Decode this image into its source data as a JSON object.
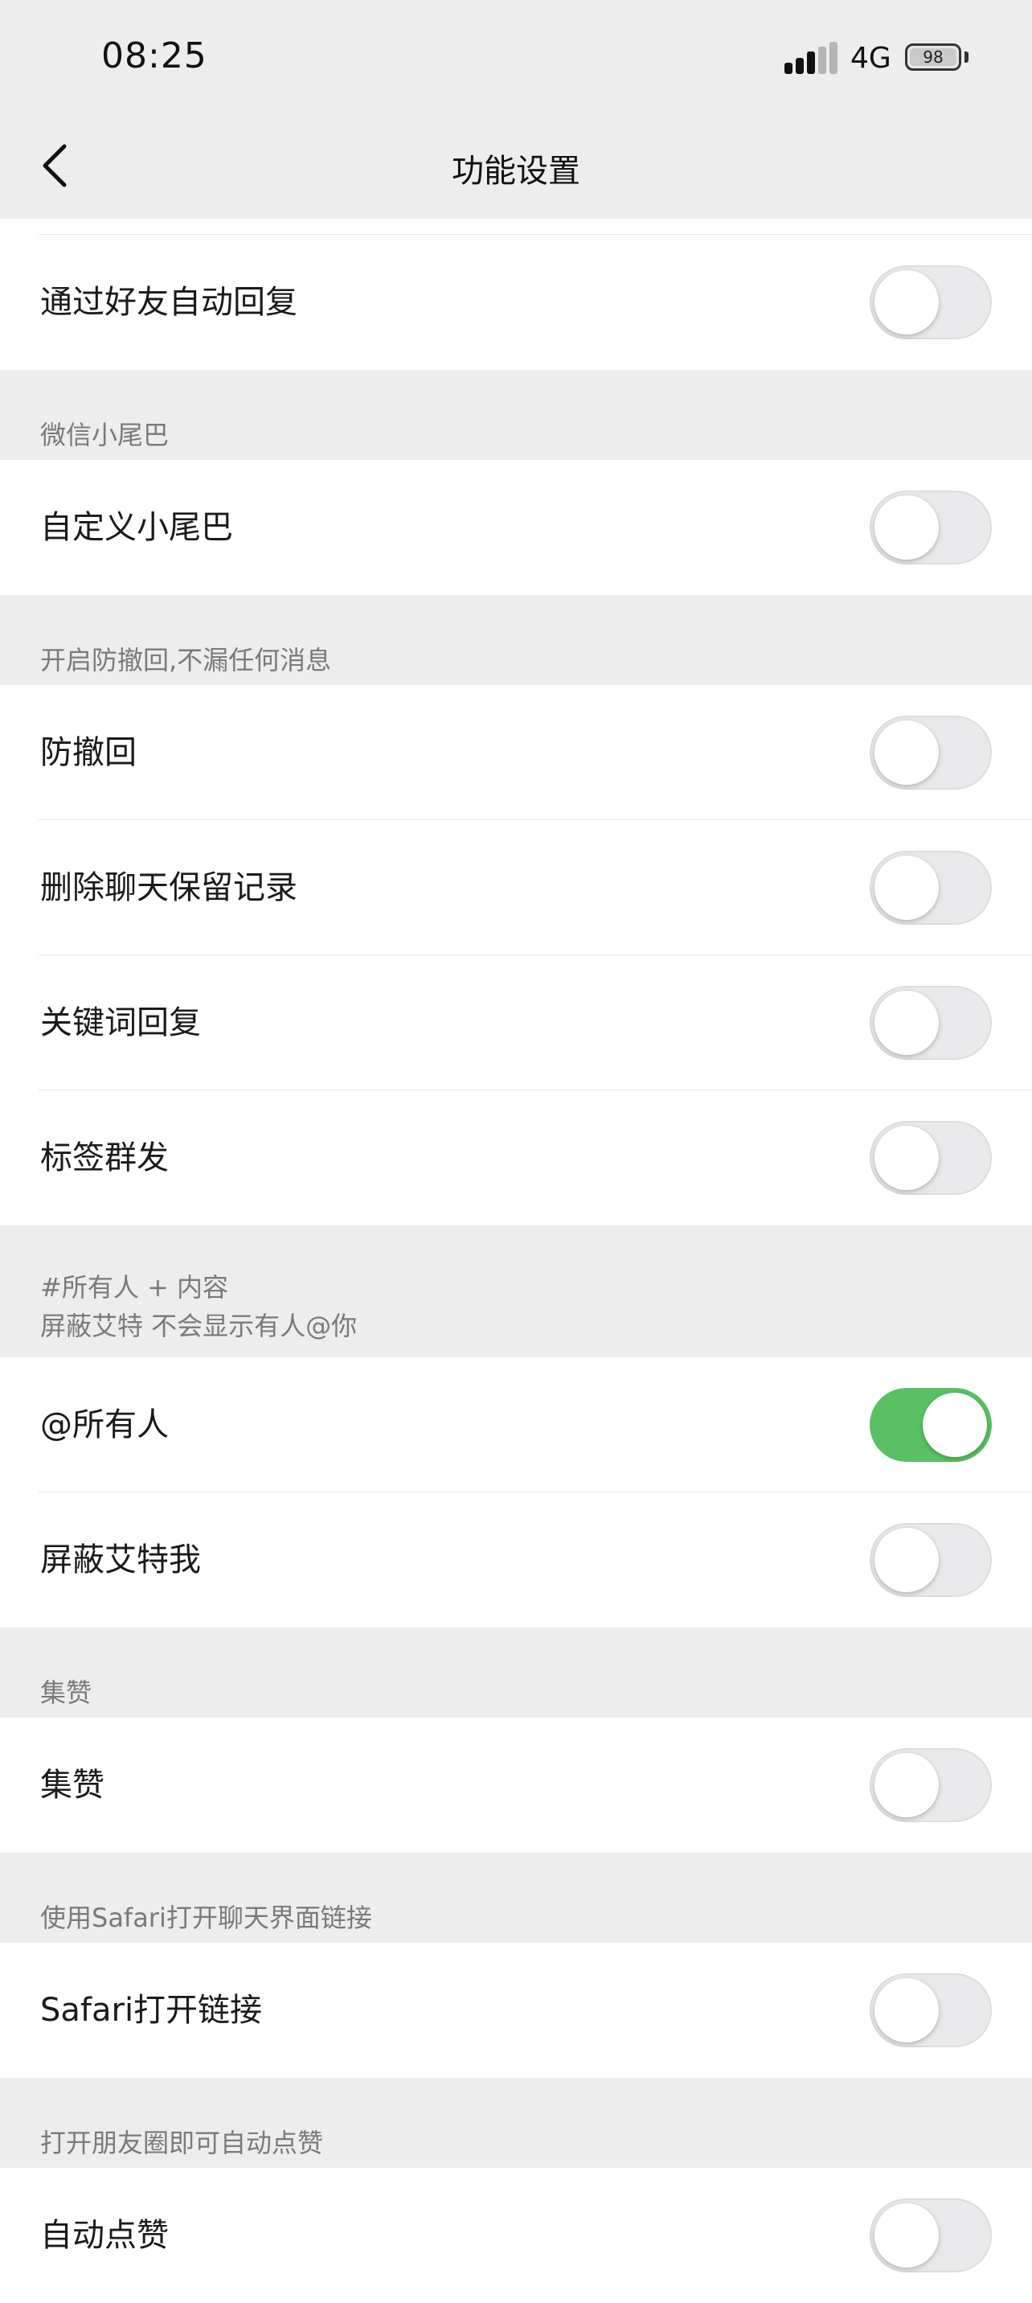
{
  "status": {
    "time": "08:25",
    "network": "4G",
    "battery": "98"
  },
  "nav": {
    "title": "功能设置",
    "back_icon": "chevron-left-icon"
  },
  "group0": {
    "items": [
      {
        "label": "通过好友自动回复",
        "on": false
      }
    ]
  },
  "sections": {
    "s1": {
      "header": "微信小尾巴"
    },
    "s2": {
      "header": "开启防撤回,不漏任何消息"
    },
    "s3": {
      "header_line1": "#所有人 + 内容",
      "header_line2": "屏蔽艾特 不会显示有人@你"
    },
    "s4": {
      "header": "集赞"
    },
    "s5": {
      "header": "使用Safari打开聊天界面链接"
    },
    "s6": {
      "header": "打开朋友圈即可自动点赞"
    }
  },
  "group1": {
    "items": [
      {
        "label": "自定义小尾巴",
        "on": false
      }
    ]
  },
  "group2": {
    "items": [
      {
        "label": "防撤回",
        "on": false
      },
      {
        "label": "删除聊天保留记录",
        "on": false
      },
      {
        "label": "关键词回复",
        "on": false
      },
      {
        "label": "标签群发",
        "on": false
      }
    ]
  },
  "group3": {
    "items": [
      {
        "label": "@所有人",
        "on": true
      },
      {
        "label": "屏蔽艾特我",
        "on": false
      }
    ]
  },
  "group4": {
    "items": [
      {
        "label": "集赞",
        "on": false
      }
    ]
  },
  "group5": {
    "items": [
      {
        "label": "Safari打开链接",
        "on": false
      }
    ]
  },
  "group6": {
    "items": [
      {
        "label": "自动点赞",
        "on": false
      }
    ]
  },
  "colors": {
    "toggle_on": "#5ac064",
    "toggle_off": "#e9e9eb",
    "background": "#ededed"
  }
}
